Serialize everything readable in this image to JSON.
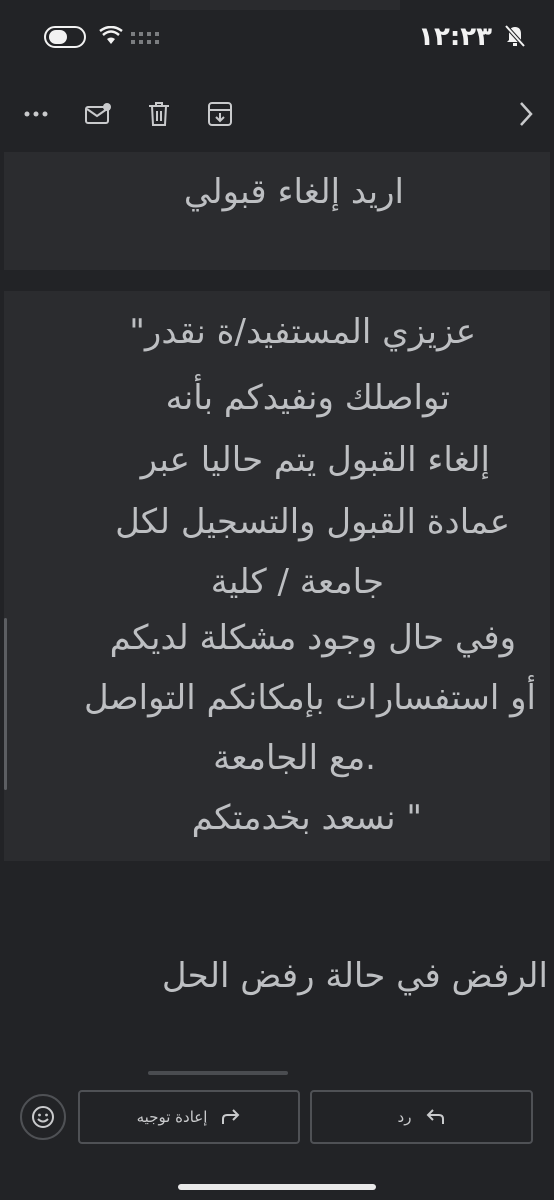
{
  "status_bar": {
    "time": "١٢:٢٣"
  },
  "toolbar": {
    "more_icon": "more-horizontal-icon",
    "mark_unread_icon": "mail-unread-icon",
    "delete_icon": "trash-icon",
    "archive_icon": "archive-icon",
    "next_icon": "chevron-right-icon"
  },
  "message": {
    "subject": "اريد إلغاء قبولي",
    "quoted_lines": [
      "عزيزي المستفيد/ة نقدر\"",
      "تواصلك ونفيدكم بأنه",
      "إلغاء القبول يتم حاليا عبر",
      "عمادة القبول والتسجيل لكل",
      "جامعة / كلية",
      "وفي حال وجود مشكلة لديكم",
      "أو استفسارات بإمكانكم التواصل",
      ".مع الجامعة",
      "\" نسعد بخدمتكم"
    ],
    "reply_text": "الرفض في حالة رفض الحل"
  },
  "actions": {
    "forward_label": "إعادة توجيه",
    "reply_label": "رد"
  },
  "colors": {
    "background": "#222326",
    "bubble": "#2b2c2f",
    "text": "#bdbfc2"
  }
}
